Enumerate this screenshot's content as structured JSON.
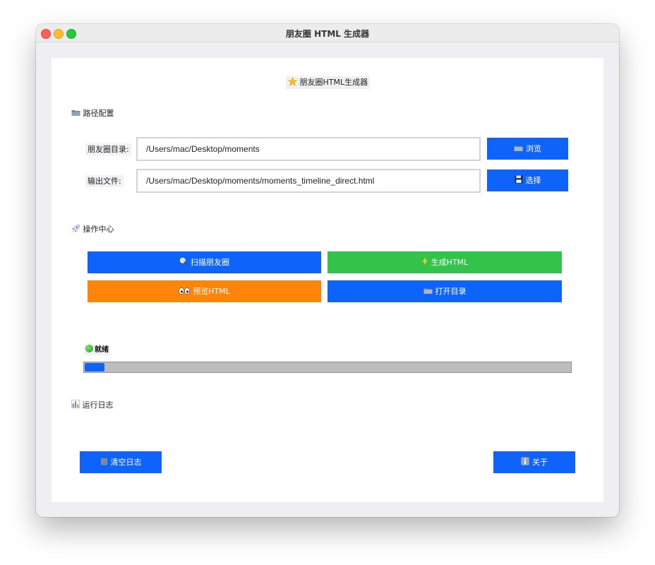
{
  "window": {
    "title": "朋友圈 HTML 生成器"
  },
  "app": {
    "heading": "朋友圈HTML生成器",
    "heading_icon": "star-icon"
  },
  "paths_section": {
    "title": "路径配置",
    "icon": "folder-icon",
    "moments_dir": {
      "label": "朋友圈目录:",
      "value": "/Users/mac/Desktop/moments",
      "button_label": "浏览",
      "button_icon": "folder-icon"
    },
    "output_file": {
      "label": "输出文件:",
      "value": "/Users/mac/Desktop/moments/moments_timeline_direct.html",
      "button_label": "选择",
      "button_icon": "floppy-disk-icon"
    }
  },
  "actions_section": {
    "title": "操作中心",
    "icon": "rocket-icon",
    "buttons": [
      {
        "label": "扫描朋友圈",
        "icon": "magnifier-icon",
        "color": "#0e63fb"
      },
      {
        "label": "生成HTML",
        "icon": "lightning-icon",
        "color": "#33c24a"
      },
      {
        "label": "预览HTML",
        "icon": "eyes-icon",
        "color": "#fe850a"
      },
      {
        "label": "打开目录",
        "icon": "folder-icon",
        "color": "#0e63fb"
      }
    ]
  },
  "status": {
    "text": "就绪",
    "indicator_color": "#2db52d",
    "progress": 0.04
  },
  "log_section": {
    "title": "运行日志",
    "icon": "bar-chart-icon"
  },
  "footer": {
    "clear_label": "清空日志",
    "clear_icon": "trash-can-icon",
    "about_label": "关于",
    "about_icon": "info-icon"
  },
  "colors": {
    "primary": "#0e63fb",
    "success": "#33c24a",
    "warning": "#fe850a"
  }
}
